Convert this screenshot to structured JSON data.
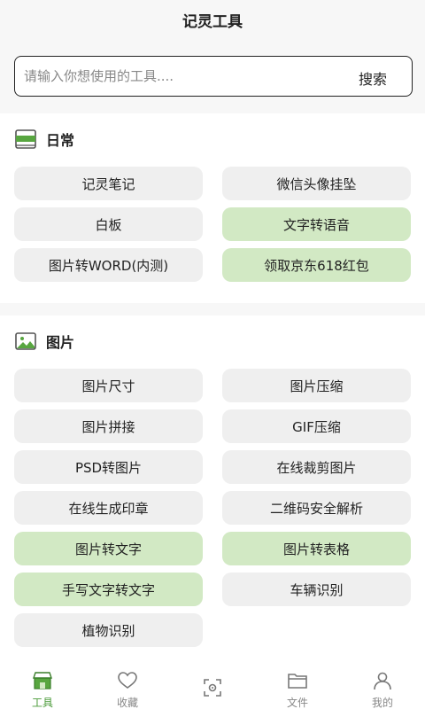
{
  "header": {
    "title": "记灵工具"
  },
  "search": {
    "placeholder": "请输入你想使用的工具....",
    "button_label": "搜索"
  },
  "sections": [
    {
      "title": "日常",
      "icon": "daily-card-icon",
      "items": [
        {
          "label": "记灵笔记",
          "highlighted": false
        },
        {
          "label": "微信头像挂坠",
          "highlighted": false
        },
        {
          "label": "白板",
          "highlighted": false
        },
        {
          "label": "文字转语音",
          "highlighted": true
        },
        {
          "label": "图片转WORD(内测)",
          "highlighted": false
        },
        {
          "label": "领取京东618红包",
          "highlighted": true
        }
      ]
    },
    {
      "title": "图片",
      "icon": "image-landscape-icon",
      "items": [
        {
          "label": "图片尺寸",
          "highlighted": false
        },
        {
          "label": "图片压缩",
          "highlighted": false
        },
        {
          "label": "图片拼接",
          "highlighted": false
        },
        {
          "label": "GIF压缩",
          "highlighted": false
        },
        {
          "label": "PSD转图片",
          "highlighted": false
        },
        {
          "label": "在线裁剪图片",
          "highlighted": false
        },
        {
          "label": "在线生成印章",
          "highlighted": false
        },
        {
          "label": "二维码安全解析",
          "highlighted": false
        },
        {
          "label": "图片转文字",
          "highlighted": true
        },
        {
          "label": "图片转表格",
          "highlighted": true
        },
        {
          "label": "手写文字转文字",
          "highlighted": true
        },
        {
          "label": "车辆识别",
          "highlighted": false
        },
        {
          "label": "植物识别",
          "highlighted": false
        }
      ]
    }
  ],
  "tabbar": {
    "items": [
      {
        "label": "工具",
        "icon": "store-icon",
        "active": true
      },
      {
        "label": "收藏",
        "icon": "heart-icon",
        "active": false
      },
      {
        "label": "",
        "icon": "scan-icon",
        "active": false
      },
      {
        "label": "文件",
        "icon": "folder-icon",
        "active": false
      },
      {
        "label": "我的",
        "icon": "user-icon",
        "active": false
      }
    ]
  },
  "colors": {
    "accent": "#4a9a38",
    "chip": "#efefef",
    "chip_highlight": "#d2e9c4"
  }
}
